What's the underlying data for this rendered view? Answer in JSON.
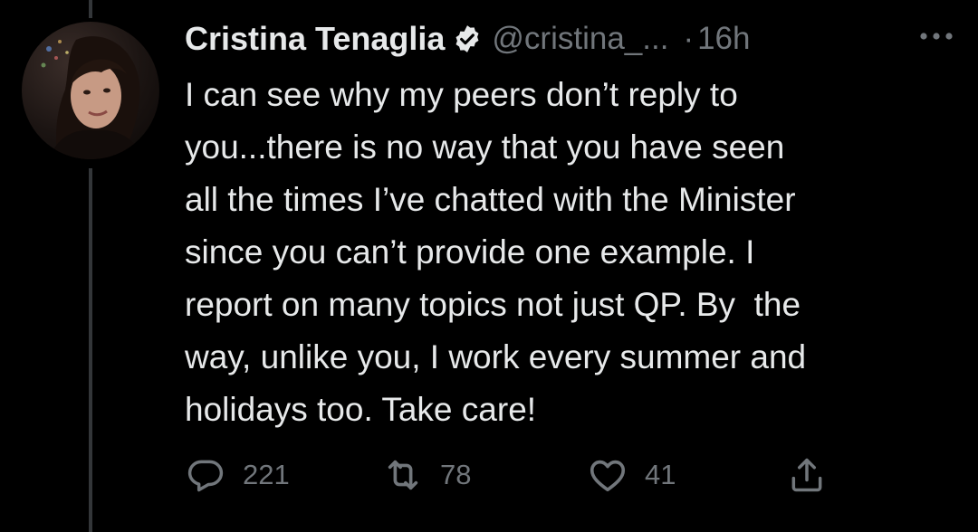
{
  "tweet": {
    "author_name": "Cristina Tenaglia",
    "handle": "@cristina_...",
    "separator": "·",
    "time": "16h",
    "text": "I can see why my peers don’t reply to\nyou...there is no way that you have seen\nall the times I’ve chatted with the Minister\nsince you can’t provide one example. I\nreport on many topics not just QP. By  the\nway, unlike you, I work every summer and\nholidays too. Take care!"
  },
  "actions": {
    "reply_count": "221",
    "retweet_count": "78",
    "like_count": "41"
  },
  "icons": {
    "verified": "verified-badge-icon",
    "more": "more-options-icon",
    "reply": "reply-icon",
    "retweet": "retweet-icon",
    "like": "heart-icon",
    "share": "share-icon"
  },
  "colors": {
    "background": "#000000",
    "primary_text": "#e7e9ea",
    "secondary_text": "#71767b",
    "thread_line": "#333639"
  }
}
